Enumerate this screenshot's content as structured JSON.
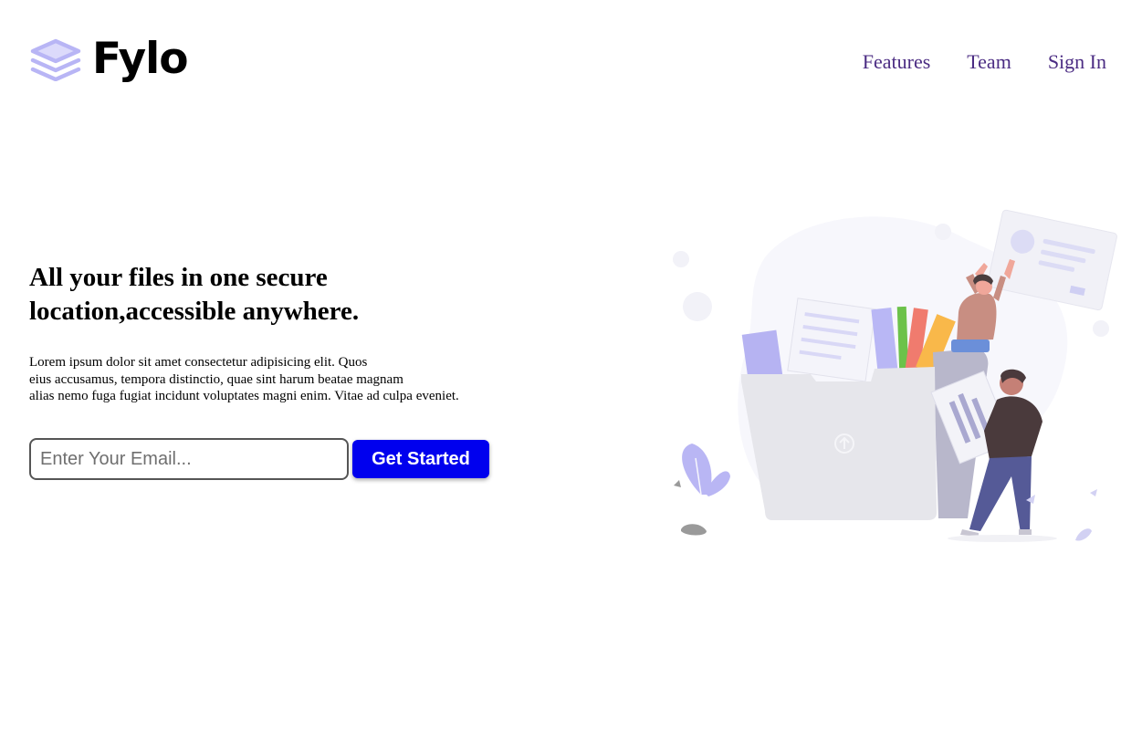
{
  "brand": {
    "name": "Fylo",
    "icon": "stacked-layers-icon",
    "icon_color": "#b8b5f5"
  },
  "nav": {
    "items": [
      {
        "label": "Features"
      },
      {
        "label": "Team"
      },
      {
        "label": "Sign In"
      }
    ],
    "link_color": "#4b2c83"
  },
  "hero": {
    "headline": "All your files in one secure location,accessible anywhere.",
    "description_lines": [
      "Lorem ipsum dolor sit amet consectetur adipisicing elit. Quos",
      "eius accusamus, tempora distinctio, quae sint harum beatae magnam",
      "alias nemo fuga fugiat incidunt voluptates magni enim. Vitae ad culpa eveniet."
    ]
  },
  "signup": {
    "email_placeholder": "Enter Your Email...",
    "email_value": "",
    "button_label": "Get Started",
    "button_color": "#0000ee"
  },
  "illustration": {
    "subject": "person-uploading-files-to-folder-illustration"
  }
}
